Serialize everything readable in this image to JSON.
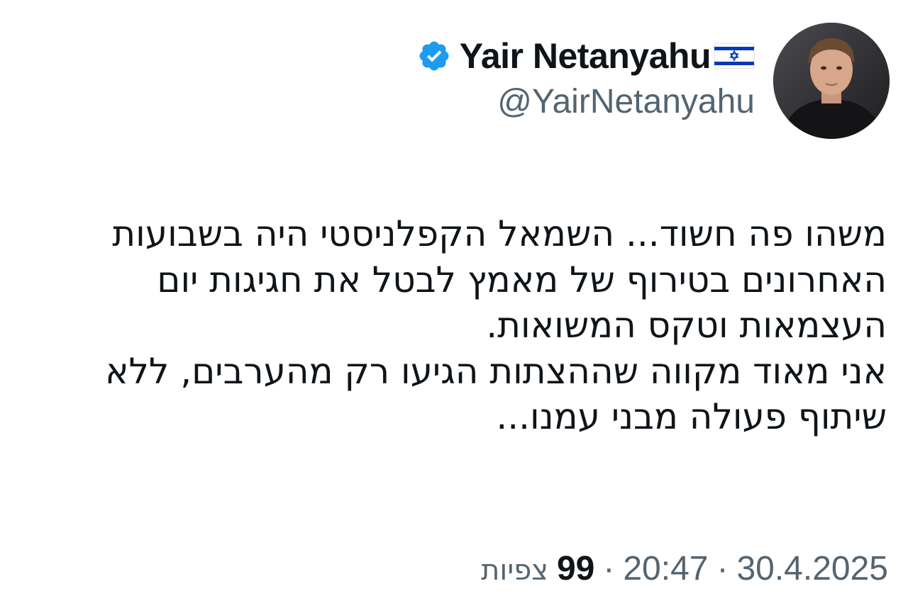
{
  "author": {
    "display_name": "Yair Netanyahu",
    "handle": "@YairNetanyahu",
    "verified_icon": "verified-badge-icon",
    "flag_icon": "israel-flag-icon"
  },
  "tweet": {
    "paragraphs": [
      "משהו פה חשוד... השמאל הקפלניסטי היה בשבועות האחרונים בטירוף של מאמץ לבטל את חגיגות יום העצמאות וטקס המשואות.",
      "אני מאוד מקווה שההצתות הגיעו רק מהערבים, ללא שיתוף פעולה מבני עמנו..."
    ]
  },
  "meta": {
    "date": "30.4.2025",
    "time": "20:47",
    "separator": "·",
    "views_count": "99",
    "views_label": "צפיות"
  },
  "colors": {
    "text": "#0f1419",
    "secondary": "#536471",
    "verified_blue": "#1d9bf0",
    "flag_blue": "#0038b8"
  }
}
